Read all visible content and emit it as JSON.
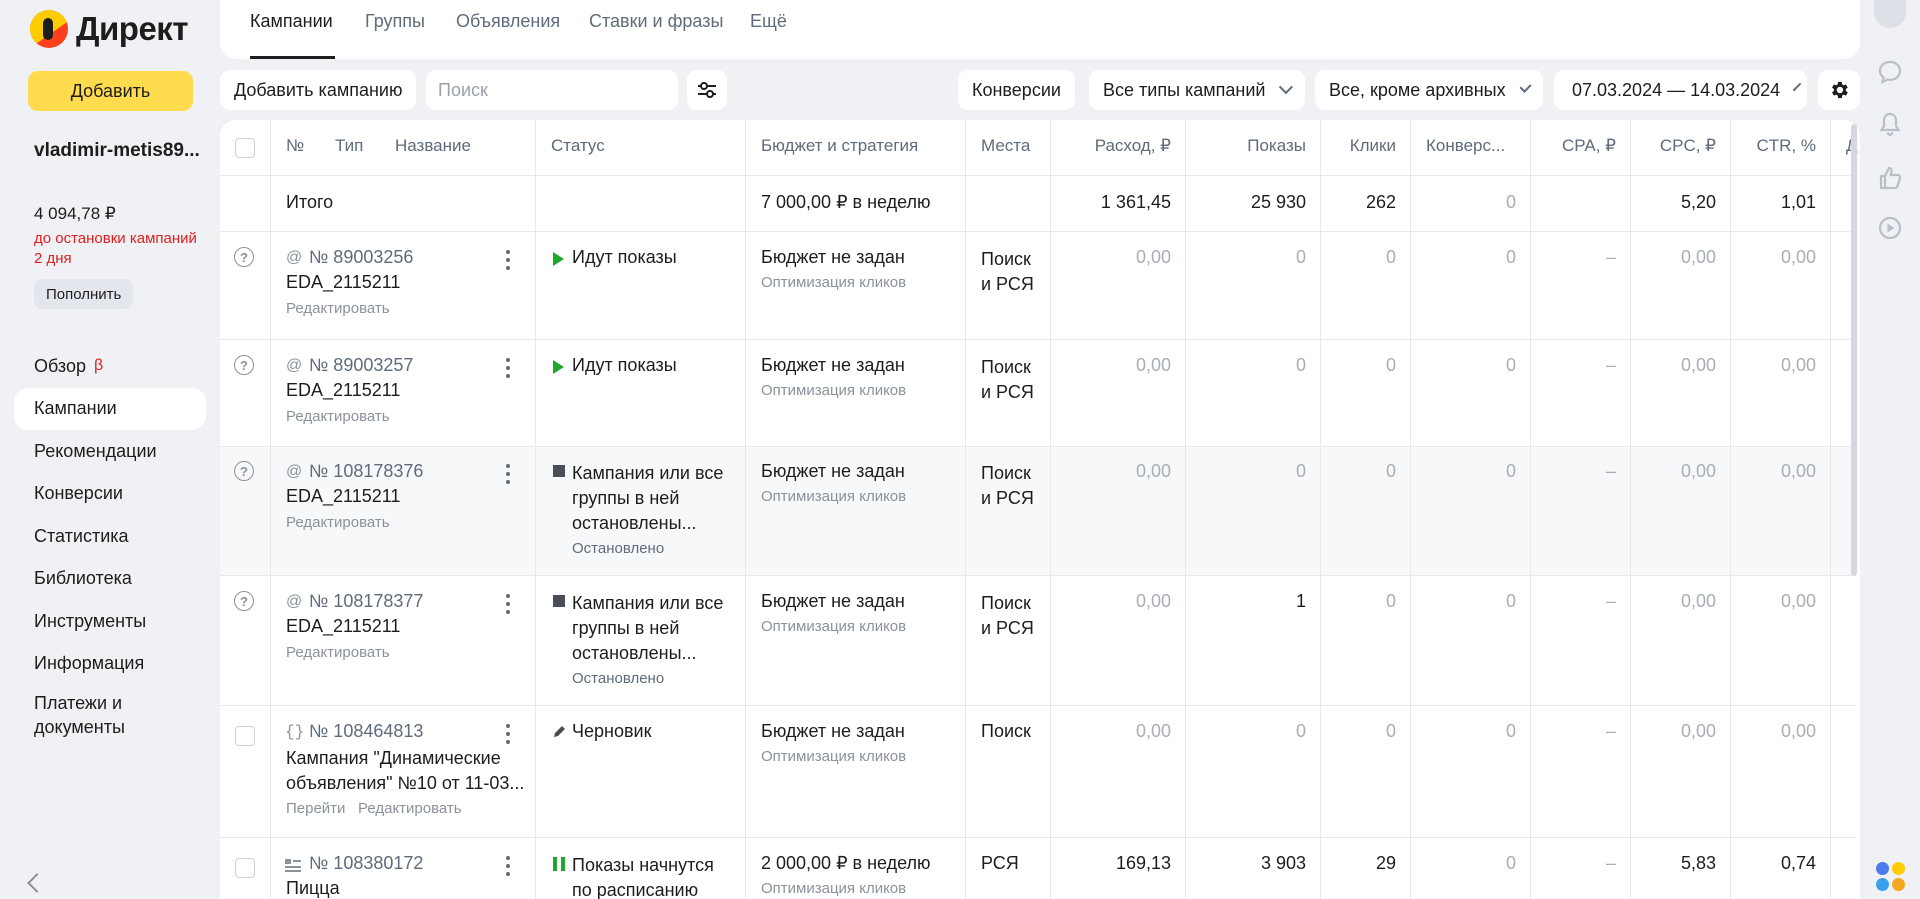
{
  "brand": {
    "name": "Директ"
  },
  "sidebar": {
    "add_label": "Добавить",
    "login": "vladimir-metis89...",
    "balance": "4 094,78 ₽",
    "balance_note": "до остановки кампаний 2 дня",
    "topup_label": "Пополнить",
    "beta_mark": "β",
    "items": [
      {
        "label": "Обзор"
      },
      {
        "label": "Кампании"
      },
      {
        "label": "Рекомендации"
      },
      {
        "label": "Конверсии"
      },
      {
        "label": "Статистика"
      },
      {
        "label": "Библиотека"
      },
      {
        "label": "Инструменты"
      },
      {
        "label": "Информация"
      },
      {
        "label": "Платежи и документы"
      }
    ]
  },
  "tabs": [
    {
      "label": "Кампании"
    },
    {
      "label": "Группы"
    },
    {
      "label": "Объявления"
    },
    {
      "label": "Ставки и фразы"
    },
    {
      "label": "Ещё"
    }
  ],
  "toolbar": {
    "add_campaign": "Добавить кампанию",
    "search_placeholder": "Поиск",
    "conversions": "Конверсии",
    "campaign_types": "Все типы кампаний",
    "archive_filter": "Все, кроме архивных",
    "date_range": "07.03.2024 — 14.03.2024"
  },
  "table": {
    "headers": {
      "num": "№",
      "type": "Тип",
      "name": "Название",
      "status": "Статус",
      "budget": "Бюджет и стратегия",
      "places": "Места",
      "spend": "Расход, ₽",
      "impressions": "Показы",
      "clicks": "Клики",
      "conversions": "Конверс...",
      "cpa": "CPA, ₽",
      "cpc": "CPC, ₽",
      "ctr": "CTR, %",
      "more": "Д"
    },
    "total": {
      "label": "Итого",
      "budget": "7 000,00 ₽ в неделю",
      "spend": "1 361,45",
      "impressions": "25 930",
      "clicks": "262",
      "conversions": "0",
      "cpc": "5,20",
      "ctr": "1,01"
    },
    "rows": [
      {
        "type_icon": "at-icon",
        "number": "№ 89003256",
        "name": "EDA_2115211",
        "action": "Редактировать",
        "status": "Идут показы",
        "budget": "Бюджет не задан",
        "strategy": "Оптимизация кликов",
        "places": "Поиск и РСЯ",
        "spend": "0,00",
        "impressions": "0",
        "clicks": "0",
        "conversions": "0",
        "cpa": "–",
        "cpc": "0,00",
        "ctr": "0,00"
      },
      {
        "type_icon": "at-icon",
        "number": "№ 89003257",
        "name": "EDA_2115211",
        "action": "Редактировать",
        "status": "Идут показы",
        "budget": "Бюджет не задан",
        "strategy": "Оптимизация кликов",
        "places": "Поиск и РСЯ",
        "spend": "0,00",
        "impressions": "0",
        "clicks": "0",
        "conversions": "0",
        "cpa": "–",
        "cpc": "0,00",
        "ctr": "0,00"
      },
      {
        "type_icon": "at-icon",
        "number": "№ 108178376",
        "name": "EDA_2115211",
        "action": "Редактировать",
        "status": "Кампания или все группы в ней остановлены...",
        "status_sub": "Остановлено",
        "budget": "Бюджет не задан",
        "strategy": "Оптимизация кликов",
        "places": "Поиск и РСЯ",
        "spend": "0,00",
        "impressions": "0",
        "clicks": "0",
        "conversions": "0",
        "cpa": "–",
        "cpc": "0,00",
        "ctr": "0,00"
      },
      {
        "type_icon": "at-icon",
        "number": "№ 108178377",
        "name": "EDA_2115211",
        "action": "Редактировать",
        "status": "Кампания или все группы в ней остановлены...",
        "status_sub": "Остановлено",
        "budget": "Бюджет не задан",
        "strategy": "Оптимизация кликов",
        "places": "Поиск и РСЯ",
        "spend": "0,00",
        "impressions": "1",
        "clicks": "0",
        "conversions": "0",
        "cpa": "–",
        "cpc": "0,00",
        "ctr": "0,00"
      },
      {
        "type_icon": "braces-icon",
        "number": "№ 108464813",
        "name": "Кампания \"Динамические объявления\" №10 от 11-03...",
        "action_go": "Перейти",
        "action": "Редактировать",
        "status": "Черновик",
        "budget": "Бюджет не задан",
        "strategy": "Оптимизация кликов",
        "places": "Поиск",
        "spend": "0,00",
        "impressions": "0",
        "clicks": "0",
        "conversions": "0",
        "cpa": "–",
        "cpc": "0,00",
        "ctr": "0,00"
      },
      {
        "type_icon": "list-icon",
        "number": "№ 108380172",
        "name": "Пицца",
        "status": "Показы начнутся по расписанию",
        "budget": "2 000,00 ₽ в неделю",
        "strategy": "Оптимизация кликов",
        "places": "РСЯ",
        "spend": "169,13",
        "impressions": "3 903",
        "clicks": "29",
        "conversions": "0",
        "cpa": "–",
        "cpc": "5,83",
        "ctr": "0,74"
      }
    ]
  }
}
